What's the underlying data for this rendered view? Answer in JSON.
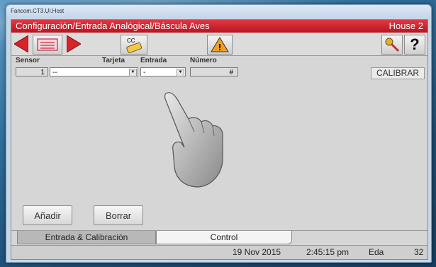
{
  "window": {
    "title": "Fancom.CT3.UI.Host"
  },
  "header": {
    "title": "Configuración/Entrada Analógical/Báscula Aves",
    "house": "House 2"
  },
  "toolbar": {
    "cc_label": "CC"
  },
  "columns": {
    "sensor": "Sensor",
    "tarjeta": "Tarjeta",
    "entrada": "Entrada",
    "numero": "Número"
  },
  "row": {
    "sensor": "1",
    "tarjeta": "--",
    "entrada": "-",
    "numero": "#"
  },
  "buttons": {
    "calibrar": "CALIBRAR",
    "anadir": "Añadir",
    "borrar": "Borrar"
  },
  "tabs": [
    {
      "label": "Entrada & Calibración",
      "active": true
    },
    {
      "label": "Control",
      "active": false
    }
  ],
  "status": {
    "date": "19 Nov 2015",
    "time": "2:45:15 pm",
    "eda": "Eda",
    "count": "32"
  },
  "colors": {
    "header": "#c8202b",
    "arrow": "#d8232a",
    "warning": "#f0a020"
  }
}
